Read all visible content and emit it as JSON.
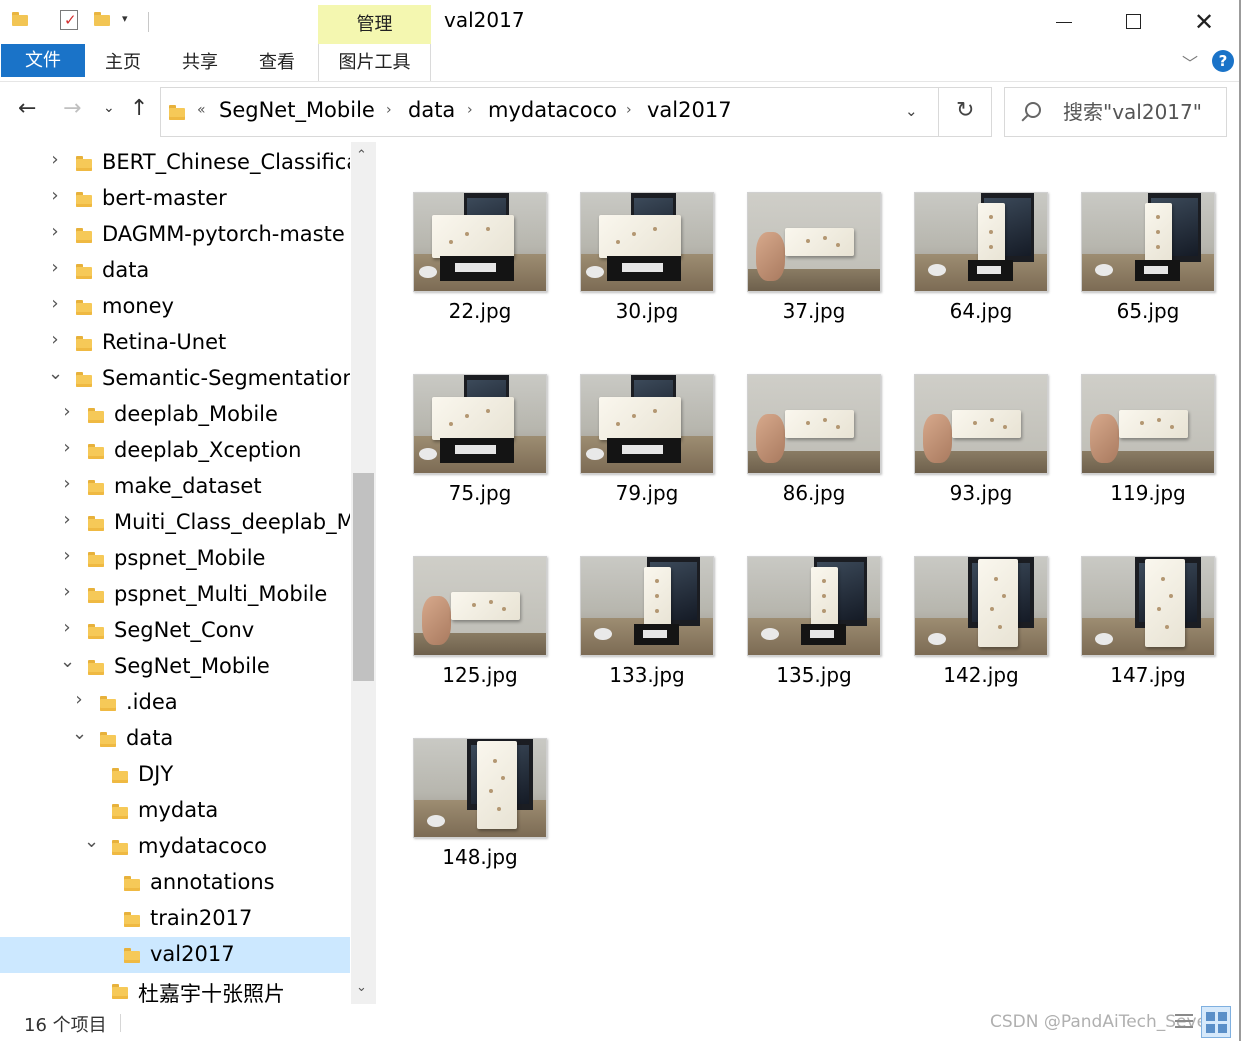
{
  "window": {
    "title": "val2017",
    "manage_tab": "管理"
  },
  "ribbon": {
    "file": "文件",
    "home": "主页",
    "share": "共享",
    "view": "查看",
    "picture_tools": "图片工具",
    "help": "?"
  },
  "address": {
    "overflow": "«",
    "crumbs": [
      "SegNet_Mobile",
      "data",
      "mydatacoco",
      "val2017"
    ]
  },
  "search": {
    "placeholder": "搜索\"val2017\""
  },
  "tree": [
    {
      "label": "BERT_Chinese_Classificat",
      "level": 0,
      "expander": "collapsed"
    },
    {
      "label": "bert-master",
      "level": 0,
      "expander": "collapsed"
    },
    {
      "label": "DAGMM-pytorch-maste",
      "level": 0,
      "expander": "collapsed"
    },
    {
      "label": "data",
      "level": 0,
      "expander": "collapsed"
    },
    {
      "label": "money",
      "level": 0,
      "expander": "collapsed"
    },
    {
      "label": "Retina-Unet",
      "level": 0,
      "expander": "collapsed"
    },
    {
      "label": "Semantic-Segmentation-",
      "level": 0,
      "expander": "expanded"
    },
    {
      "label": "deeplab_Mobile",
      "level": 1,
      "expander": "collapsed"
    },
    {
      "label": "deeplab_Xception",
      "level": 1,
      "expander": "collapsed"
    },
    {
      "label": "make_dataset",
      "level": 1,
      "expander": "collapsed"
    },
    {
      "label": "Muiti_Class_deeplab_M",
      "level": 1,
      "expander": "collapsed"
    },
    {
      "label": "pspnet_Mobile",
      "level": 1,
      "expander": "collapsed"
    },
    {
      "label": "pspnet_Multi_Mobile",
      "level": 1,
      "expander": "collapsed"
    },
    {
      "label": "SegNet_Conv",
      "level": 1,
      "expander": "collapsed"
    },
    {
      "label": "SegNet_Mobile",
      "level": 1,
      "expander": "expanded"
    },
    {
      "label": ".idea",
      "level": 2,
      "expander": "collapsed"
    },
    {
      "label": "data",
      "level": 2,
      "expander": "expanded"
    },
    {
      "label": "DJY",
      "level": 3,
      "expander": "none"
    },
    {
      "label": "mydata",
      "level": 3,
      "expander": "none"
    },
    {
      "label": "mydatacoco",
      "level": 3,
      "expander": "expanded"
    },
    {
      "label": "annotations",
      "level": 4,
      "expander": "none"
    },
    {
      "label": "train2017",
      "level": 4,
      "expander": "none"
    },
    {
      "label": "val2017",
      "level": 4,
      "expander": "none",
      "selected": true
    },
    {
      "label": "杜嘉宇十张照片",
      "level": 3,
      "expander": "none"
    }
  ],
  "files": [
    {
      "name": "22.jpg",
      "scene": "block-flat"
    },
    {
      "name": "30.jpg",
      "scene": "block-flat"
    },
    {
      "name": "37.jpg",
      "scene": "hand-wall"
    },
    {
      "name": "64.jpg",
      "scene": "block-upright"
    },
    {
      "name": "65.jpg",
      "scene": "block-upright"
    },
    {
      "name": "75.jpg",
      "scene": "block-flat"
    },
    {
      "name": "79.jpg",
      "scene": "block-flat"
    },
    {
      "name": "86.jpg",
      "scene": "hand-wall"
    },
    {
      "name": "93.jpg",
      "scene": "hand-wall"
    },
    {
      "name": "119.jpg",
      "scene": "hand-wall"
    },
    {
      "name": "125.jpg",
      "scene": "hand-wall"
    },
    {
      "name": "133.jpg",
      "scene": "block-upright"
    },
    {
      "name": "135.jpg",
      "scene": "block-upright"
    },
    {
      "name": "142.jpg",
      "scene": "block-tall"
    },
    {
      "name": "147.jpg",
      "scene": "block-tall"
    },
    {
      "name": "148.jpg",
      "scene": "block-tall"
    }
  ],
  "status": {
    "count": "16 个项目",
    "watermark": "CSDN @PandAiTech_Seven"
  },
  "colors": {
    "accent": "#1a73c8",
    "selection": "#cce8ff",
    "manage_tab": "#f4f7b0",
    "folder": "#f6c958"
  },
  "icons": {
    "back": "arrow-left-icon",
    "forward": "arrow-right-icon",
    "up": "arrow-up-icon",
    "refresh": "refresh-icon",
    "search": "search-icon"
  }
}
